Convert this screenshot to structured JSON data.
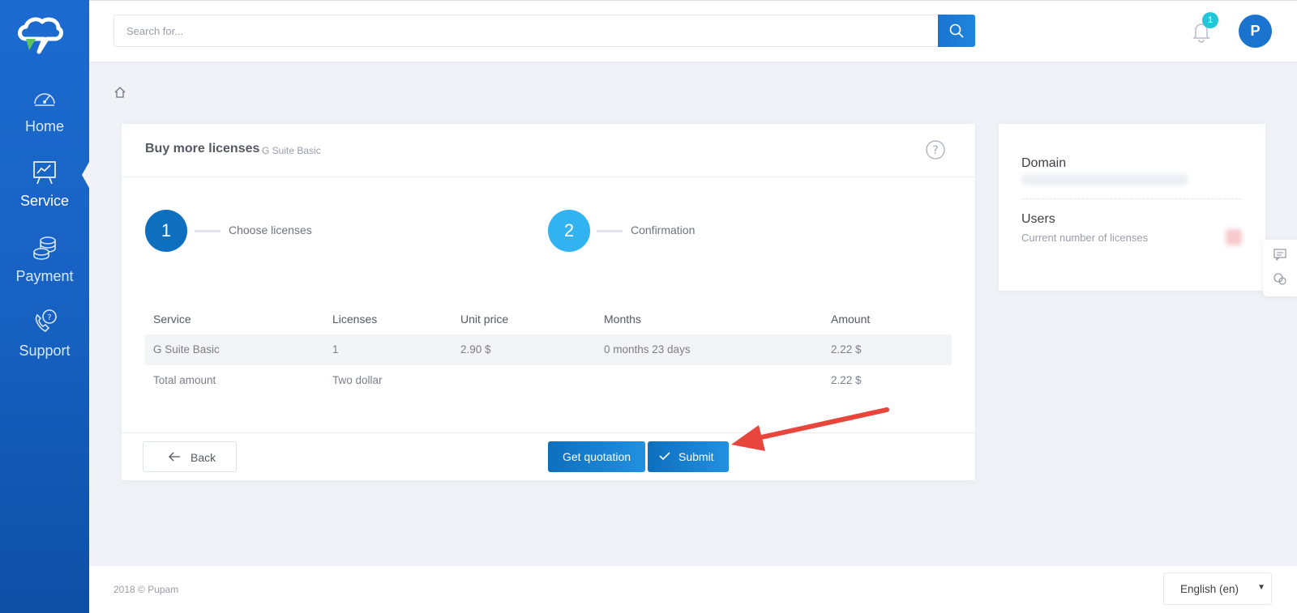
{
  "colors": {
    "primary": "#1a74cf",
    "step2": "#30b3f0",
    "badge": "#23c6d8",
    "annotation": "#e8453c"
  },
  "sidebar": {
    "items": [
      {
        "label": "Home",
        "icon": "speedometer-icon"
      },
      {
        "label": "Service",
        "icon": "presentation-chart-icon",
        "active": true
      },
      {
        "label": "Payment",
        "icon": "coins-icon"
      },
      {
        "label": "Support",
        "icon": "phone-help-icon"
      }
    ]
  },
  "topbar": {
    "search_placeholder": "Search for...",
    "notification_count": "1",
    "avatar_initial": "P"
  },
  "card": {
    "title": "Buy more licenses",
    "subtitle": "G Suite Basic",
    "steps": [
      {
        "number": "1",
        "label": "Choose licenses"
      },
      {
        "number": "2",
        "label": "Confirmation"
      }
    ],
    "table": {
      "headers": [
        "Service",
        "Licenses",
        "Unit price",
        "Months",
        "Amount"
      ],
      "rows": [
        [
          "G Suite Basic",
          "1",
          "2.90 $",
          "0 months 23 days",
          "2.22 $"
        ]
      ],
      "total": {
        "label": "Total amount",
        "words": "Two dollar",
        "amount": "2.22 $"
      }
    },
    "buttons": {
      "back": "Back",
      "quotation": "Get quotation",
      "submit": "Submit"
    }
  },
  "side_card": {
    "domain_title": "Domain",
    "users_title": "Users",
    "users_desc": "Current number of licenses"
  },
  "footer": {
    "copyright": "2018 © Pupam",
    "language": "English (en)"
  }
}
